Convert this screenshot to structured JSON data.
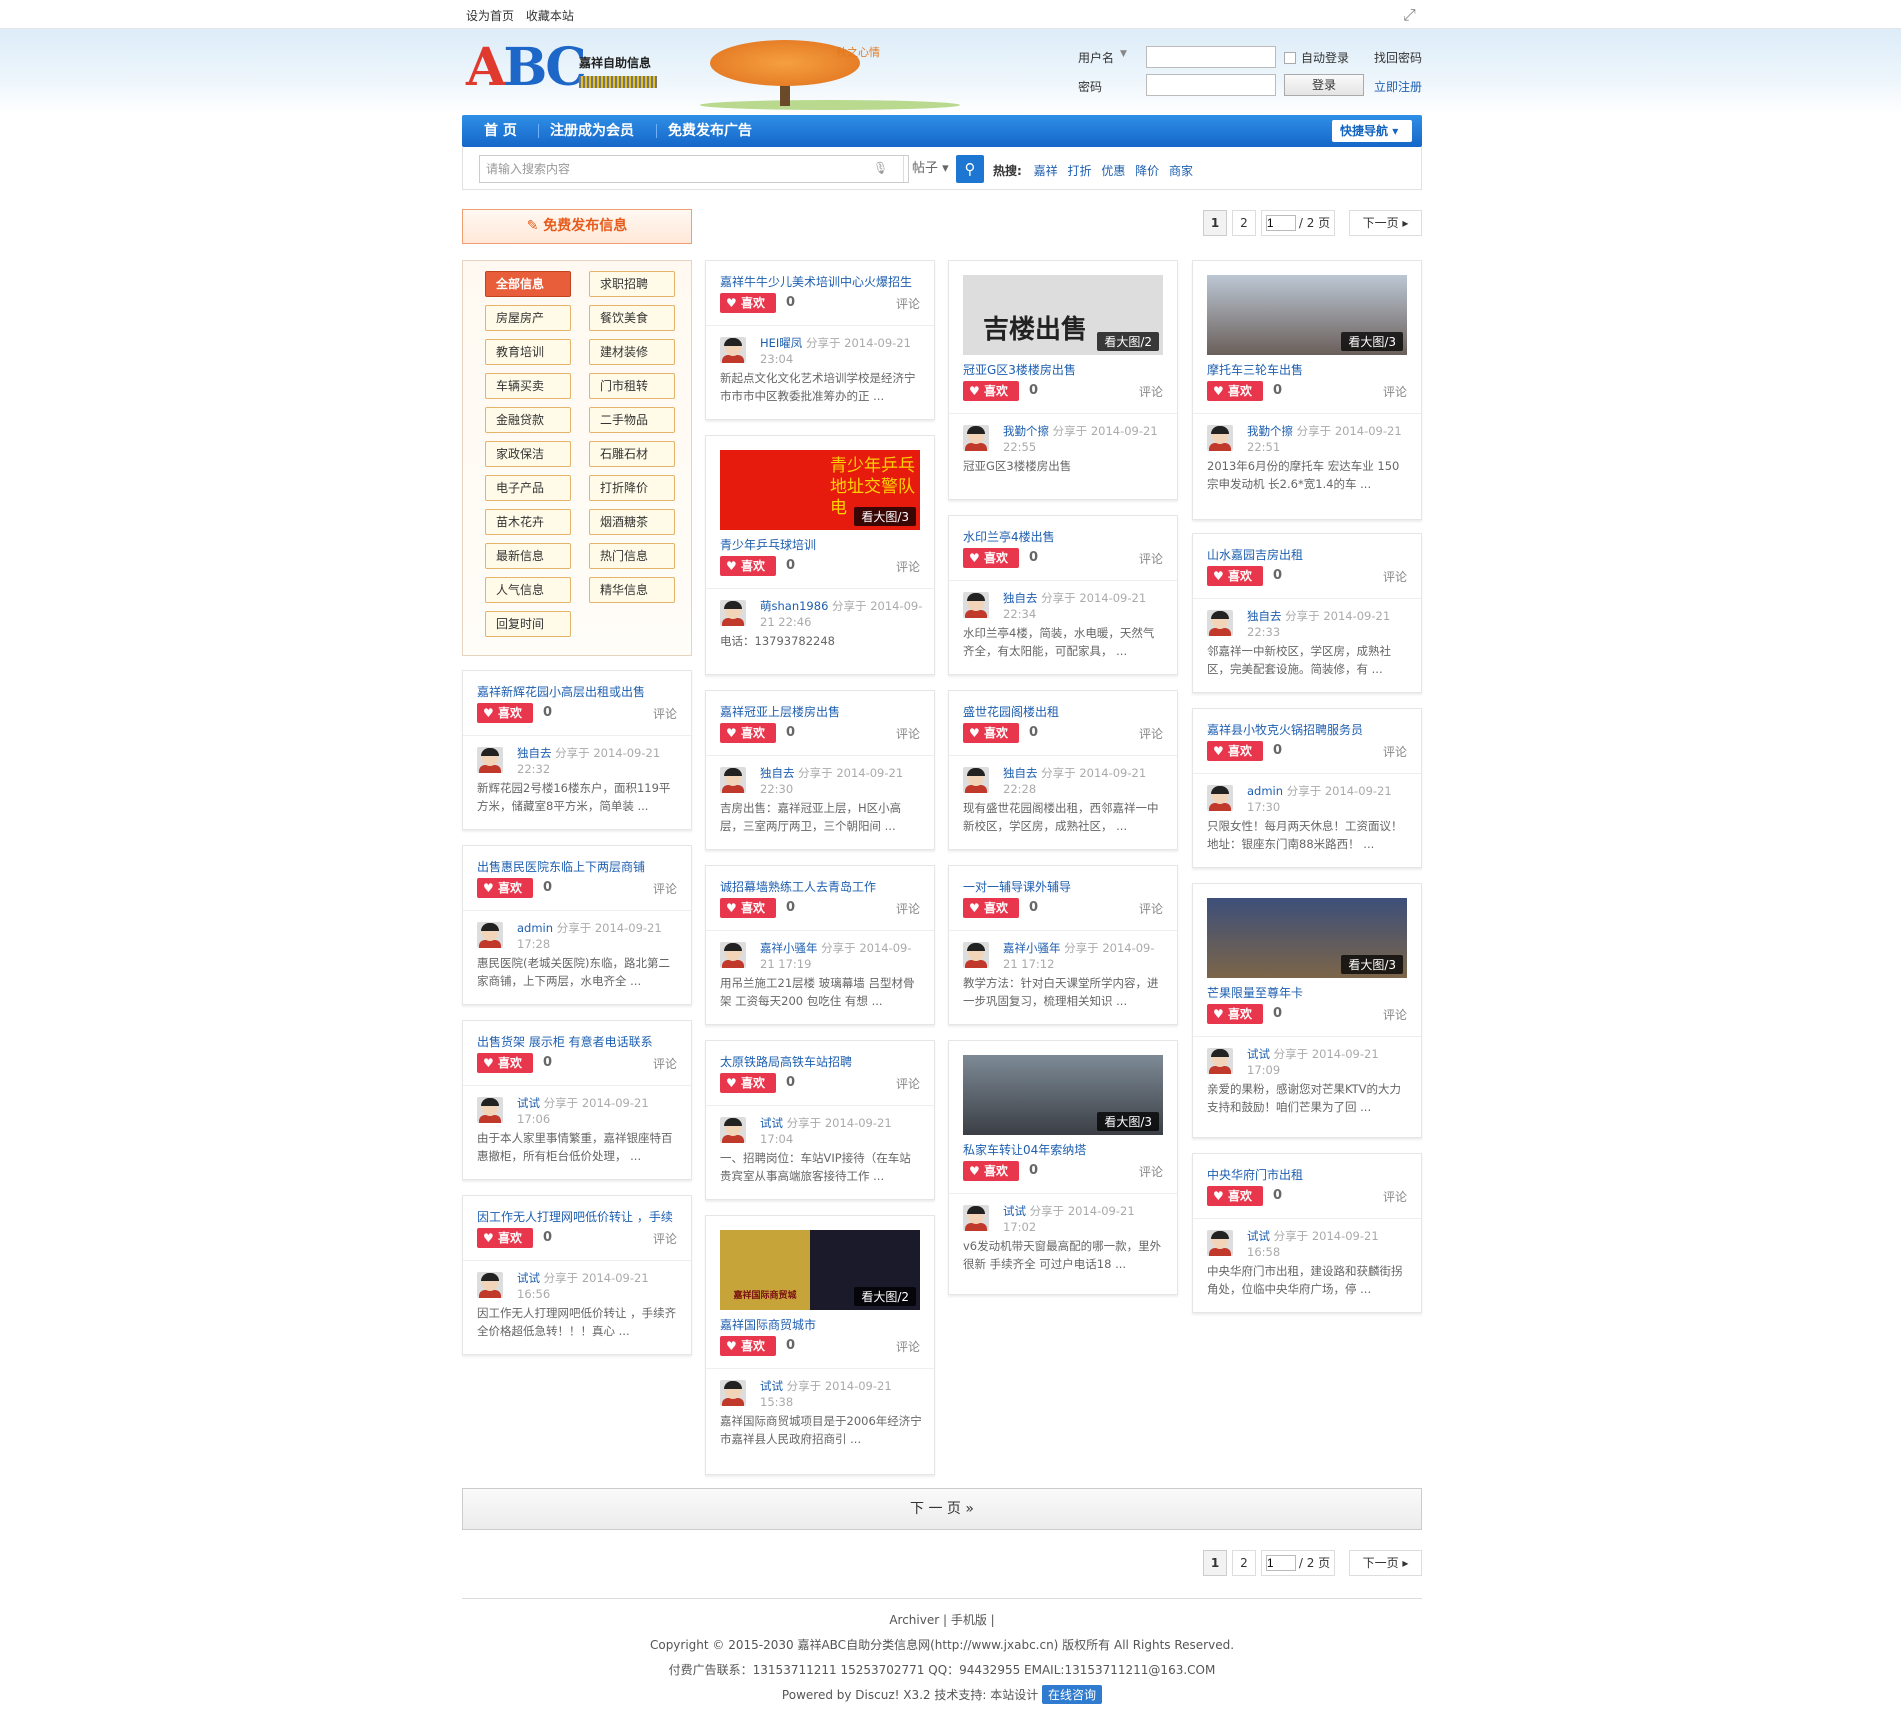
{
  "topbar": {
    "set_home": "设为首页",
    "bookmark": "收藏本站"
  },
  "logo": {
    "letters": "ABC",
    "subtitle": "嘉祥自助信息"
  },
  "banner": {
    "text": "秋之心情"
  },
  "login": {
    "username_label": "用户名",
    "password_label": "密码",
    "auto_login": "自动登录",
    "login_btn": "登录",
    "find_pwd": "找回密码",
    "register": "立即注册"
  },
  "nav": {
    "items": [
      "首 页",
      "注册成为会员",
      "免费发布广告"
    ],
    "quick_nav": "快捷导航"
  },
  "search": {
    "placeholder": "请输入搜索内容",
    "type": "帖子",
    "hot_label": "热搜:",
    "hot_words": [
      "嘉祥",
      "打折",
      "优惠",
      "降价",
      "商家"
    ]
  },
  "post_free": "免费发布信息",
  "pager": {
    "page1": "1",
    "page2": "2",
    "input": "1",
    "total": "/ 2 页",
    "next": "下一页"
  },
  "categories": [
    "全部信息",
    "求职招聘",
    "房屋房产",
    "餐饮美食",
    "教育培训",
    "建材装修",
    "车辆买卖",
    "门市租转",
    "金融贷款",
    "二手物品",
    "家政保洁",
    "石雕石材",
    "电子产品",
    "打折降价",
    "苗木花卉",
    "烟酒糖茶",
    "最新信息",
    "热门信息",
    "人气信息",
    "精华信息",
    "回复时间"
  ],
  "labels": {
    "like": "喜欢",
    "comment": "评论",
    "more_img_prefix": "看大图/",
    "share": "分享于"
  },
  "cards": [
    {
      "title": "嘉祥新辉花园小高层出租或出售",
      "likes": "0",
      "user": "独自去",
      "date": "2014-09-21",
      "time": "22:32",
      "desc": "新辉花园2号楼16楼东户，面积119平方米，储藏室8平方米，简单装 ..."
    },
    {
      "title": "出售惠民医院东临上下两层商铺",
      "likes": "0",
      "user": "admin",
      "date": "2014-09-21",
      "time": "17:28",
      "desc": "惠民医院(老城关医院)东临，路北第二家商铺，上下两层，水电齐全 ..."
    },
    {
      "title": "出售货架 展示柜 有意者电话联系",
      "likes": "0",
      "user": "试试",
      "date": "2014-09-21",
      "time": "17:06",
      "desc": "由于本人家里事情繁重，嘉祥银座特百惠撤柜，所有柜台低价处理， ..."
    },
    {
      "title": "因工作无人打理网吧低价转让 ，手续",
      "likes": "0",
      "user": "试试",
      "date": "2014-09-21",
      "time": "16:56",
      "desc": "因工作无人打理网吧低价转让 ，手续齐全价格超低急转！！！真心 ..."
    },
    {
      "title": "嘉祥牛牛少儿美术培训中心火爆招生",
      "likes": "0",
      "user": "HEI曜凤",
      "date": "2014-09-21",
      "time": "23:04",
      "desc": "新起点文化文化艺术培训学校是经济宁市市市中区教委批准筹办的正 ..."
    },
    {
      "title": "青少年乒乓球培训",
      "likes": "0",
      "user": "萌shan1986",
      "date": "2014-09-",
      "time": "21 22:46",
      "desc": "电话：13793782248",
      "img_count": "3",
      "img_text": "青少年乒乓 地址交警队 电"
    },
    {
      "title": "嘉祥冠亚上层楼房出售",
      "likes": "0",
      "user": "独自去",
      "date": "2014-09-21",
      "time": "22:30",
      "desc": "吉房出售：嘉祥冠亚上层，H区小高层，三室两厅两卫，三个朝阳间 ..."
    },
    {
      "title": "诚招幕墙熟练工人去青岛工作",
      "likes": "0",
      "user": "嘉祥小骚年",
      "date": "2014-09-",
      "time": "21 17:19",
      "desc": "用吊兰施工21层楼 玻璃幕墙 吕型材骨架 工资每天200 包吃住 有想 ..."
    },
    {
      "title": "太原铁路局高铁车站招聘",
      "likes": "0",
      "user": "试试",
      "date": "2014-09-21",
      "time": "17:04",
      "desc": "一、招聘岗位：车站VIP接待（在车站贵宾室从事高端旅客接待工作 ..."
    },
    {
      "title": "嘉祥国际商贸城市",
      "likes": "0",
      "user": "试试",
      "date": "2014-09-21",
      "time": "15:38",
      "desc": "嘉祥国际商贸城项目是于2006年经济宁市嘉祥县人民政府招商引 ...",
      "img_count": "2",
      "img_text": "嘉祥国际商贸城"
    },
    {
      "title": "冠亚G区3楼楼房出售",
      "likes": "0",
      "user": "我勤个擦",
      "date": "2014-09-21",
      "time": "22:55",
      "desc": "冠亚G区3楼楼房出售",
      "img_count": "2",
      "img_text": "吉楼出售"
    },
    {
      "title": "水印兰亭4楼出售",
      "likes": "0",
      "user": "独自去",
      "date": "2014-09-21",
      "time": "22:34",
      "desc": "水印兰亭4楼，简装，水电暖，天然气齐全，有太阳能，可配家具， ..."
    },
    {
      "title": "盛世花园阁楼出租",
      "likes": "0",
      "user": "独自去",
      "date": "2014-09-21",
      "time": "22:28",
      "desc": "现有盛世花园阁楼出租，西邻嘉祥一中新校区，学区房，成熟社区， ..."
    },
    {
      "title": "一对一辅导课外辅导",
      "likes": "0",
      "user": "嘉祥小骚年",
      "date": "2014-09-",
      "time": "21 17:12",
      "desc": "教学方法：针对白天课堂所学内容，进一步巩固复习，梳理相关知识 ..."
    },
    {
      "title": "私家车转让04年索纳塔",
      "likes": "0",
      "user": "试试",
      "date": "2014-09-21",
      "time": "17:02",
      "desc": "v6发动机带天窗最高配的哪一款，里外很新 手续齐全 可过户电话18 ...",
      "img_count": "3"
    },
    {
      "title": "摩托车三轮车出售",
      "likes": "0",
      "user": "我勤个擦",
      "date": "2014-09-21",
      "time": "22:51",
      "desc": "2013年6月份的摩托车 宏达车业 150宗申发动机 长2.6*宽1.4的车 ...",
      "img_count": "3"
    },
    {
      "title": "山水嘉园吉房出租",
      "likes": "0",
      "user": "独自去",
      "date": "2014-09-21",
      "time": "22:33",
      "desc": "邻嘉祥一中新校区，学区房，成熟社区，完美配套设施。简装修，有 ..."
    },
    {
      "title": "嘉祥县小牧克火锅招聘服务员",
      "likes": "0",
      "user": "admin",
      "date": "2014-09-21",
      "time": "17:30",
      "desc": "只限女性！每月两天休息！工资面议！地址：银座东门南88米路西！ ..."
    },
    {
      "title": "芒果限量至尊年卡",
      "likes": "0",
      "user": "试试",
      "date": "2014-09-21",
      "time": "17:09",
      "desc": "亲爱的果粉，感谢您对芒果KTV的大力支持和鼓励！咱们芒果为了回 ...",
      "img_count": "3"
    },
    {
      "title": "中央华府门市出租",
      "likes": "0",
      "user": "试试",
      "date": "2014-09-21",
      "time": "16:58",
      "desc": "中央华府门市出租，建设路和获麟街拐角处，位临中央华府广场，停 ..."
    }
  ],
  "load_more": "下 一 页   »",
  "footer": {
    "links": "Archiver  |  手机版  |",
    "copyright": "Copyright © 2015-2030 嘉祥ABC自助分类信息网(http://www.jxabc.cn) 版权所有 All Rights Reserved.",
    "contact": "付费广告联系：13153711211 15253702771 QQ：94432955 EMAIL:13153711211@163.COM",
    "powered": "Powered by Discuz! X3.2  技术支持: 本站设计",
    "online": "在线咨询"
  }
}
